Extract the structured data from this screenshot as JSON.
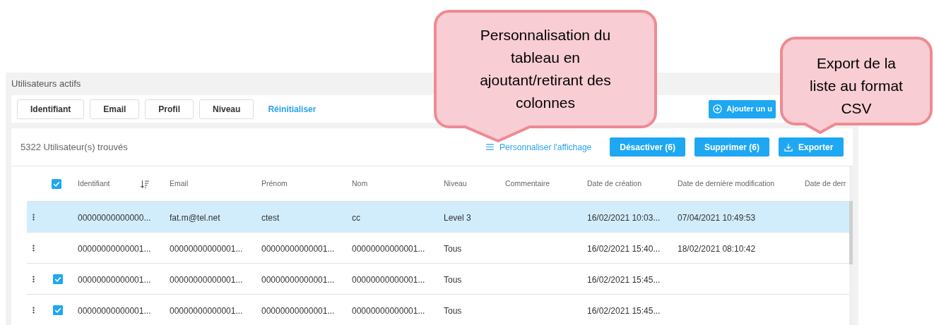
{
  "panel": {
    "title": "Utilisateurs actifs"
  },
  "filters": [
    "Identifiant",
    "Email",
    "Profil",
    "Niveau"
  ],
  "reset_link": "Réinitialiser",
  "add_button": "Ajouter un u",
  "results": {
    "count": "5322 Utilisateur(s) trouvés",
    "customize_link": "Personnaliser l'affichage",
    "buttons": [
      "Désactiver (6)",
      "Supprimer (6)"
    ],
    "export_button": "Exporter"
  },
  "table": {
    "all_checked": true,
    "columns": [
      "Identifiant",
      "Email",
      "Prénom",
      "Nom",
      "Niveau",
      "Commentaire",
      "Date de création",
      "Date de dernière modification",
      "Date de derr"
    ],
    "rows": [
      {
        "selected": true,
        "checked": false,
        "cells": [
          "00000000000000...",
          "fat.m@tel.net",
          "ctest",
          "cc",
          "Level 3",
          "",
          "16/02/2021 10:03...",
          "07/04/2021 10:49:53",
          ""
        ]
      },
      {
        "selected": false,
        "checked": false,
        "cells": [
          "00000000000001...",
          "00000000000001...",
          "00000000000001...",
          "00000000000001...",
          "Tous",
          "",
          "16/02/2021 15:40...",
          "18/02/2021 08:10:42",
          ""
        ]
      },
      {
        "selected": false,
        "checked": true,
        "cells": [
          "00000000000001...",
          "00000000000001...",
          "00000000000001...",
          "00000000000001...",
          "Tous",
          "",
          "16/02/2021 15:45...",
          "",
          ""
        ]
      },
      {
        "selected": false,
        "checked": true,
        "cells": [
          "00000000000001...",
          "00000000000001...",
          "00000000000001...",
          "00000000000001...",
          "Tous",
          "",
          "16/02/2021 15:45...",
          "",
          ""
        ]
      }
    ]
  },
  "callouts": [
    "Personnalisation du tableau en ajoutant/retirant des colonnes",
    "Export de la liste au format CSV"
  ]
}
